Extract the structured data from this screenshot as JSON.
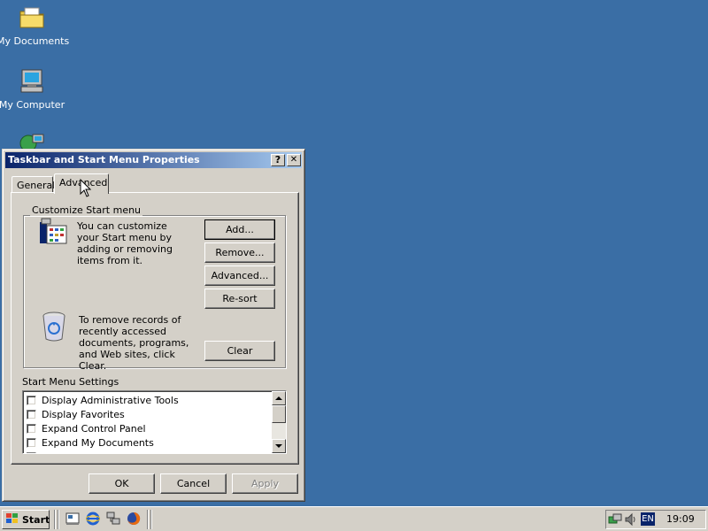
{
  "desktop": {
    "icons": [
      {
        "label": "My Documents",
        "icon": "folder-icon"
      },
      {
        "label": "My Computer",
        "icon": "computer-icon"
      },
      {
        "label": "",
        "icon": "network-places-icon"
      }
    ]
  },
  "window": {
    "title": "Taskbar and Start Menu Properties",
    "help_button": "?",
    "close_button": "✕",
    "tabs": [
      {
        "label": "General",
        "active": false
      },
      {
        "label": "Advanced",
        "active": true
      }
    ],
    "customize_group": {
      "label": "Customize Start menu",
      "description": "You can customize your Start menu by adding or removing items from it.",
      "buttons": {
        "add": "Add...",
        "remove": "Remove...",
        "advanced": "Advanced...",
        "resort": "Re-sort"
      },
      "clear_description": "To remove records of recently accessed documents, programs, and Web sites,  click Clear.",
      "clear_button": "Clear"
    },
    "settings": {
      "label": "Start Menu Settings",
      "items": [
        {
          "label": "Display Administrative Tools",
          "checked": false
        },
        {
          "label": "Display Favorites",
          "checked": false
        },
        {
          "label": "Expand Control Panel",
          "checked": false
        },
        {
          "label": "Expand My Documents",
          "checked": false
        }
      ]
    },
    "footer": {
      "ok": "OK",
      "cancel": "Cancel",
      "apply": "Apply"
    }
  },
  "taskbar": {
    "start_label": "Start",
    "quick_launch": [
      "show-desktop-icon",
      "internet-explorer-icon",
      "network-icon",
      "firefox-icon"
    ],
    "tray": {
      "language": "EN",
      "clock": "19:09"
    }
  },
  "colors": {
    "desktop": "#3a6ea5",
    "titlebar_start": "#0a246a",
    "titlebar_end": "#a6caf0",
    "face": "#d4d0c8"
  }
}
